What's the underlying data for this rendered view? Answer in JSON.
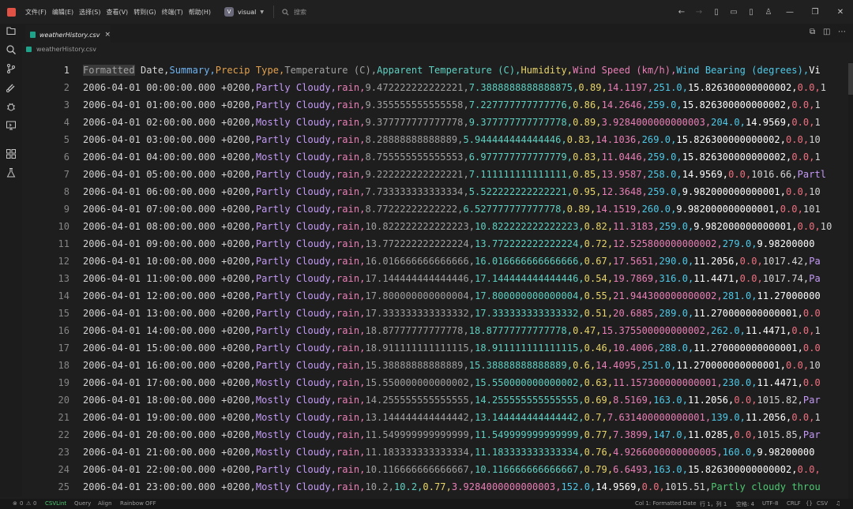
{
  "menu": [
    "文件(F)",
    "编辑(E)",
    "选择(S)",
    "查看(V)",
    "转到(G)",
    "终端(T)",
    "帮助(H)"
  ],
  "workspace": {
    "icon": "V",
    "name": "visual"
  },
  "search": {
    "placeholder": "搜索"
  },
  "tab": {
    "title": "weatherHistory.csv",
    "close": "×"
  },
  "breadcrumb": {
    "file": "weatherHistory.csv"
  },
  "colors": {
    "gray": "#a0a0a0",
    "blue": "#6fb3f0",
    "orange": "#e2a14e",
    "purple": "#c49af7",
    "teal": "#5fd1c2",
    "yellow": "#e8d56a",
    "pink": "#e97fb6",
    "cyan": "#4ec9e8",
    "white": "#ffffff",
    "green": "#4ec972",
    "red": "#f07080",
    "plain": "#d4d4d4"
  },
  "lines": [
    {
      "n": "1",
      "segs": [
        [
          "Formatted",
          "gray"
        ],
        [
          " Date,",
          "plain"
        ],
        [
          "Summary,",
          "blue"
        ],
        [
          "Precip Type,",
          "orange"
        ],
        [
          "Temperature (C),",
          "gray"
        ],
        [
          "Apparent Temperature (C),",
          "teal"
        ],
        [
          "Humidity,",
          "yellow"
        ],
        [
          "Wind Speed (km/h),",
          "pink"
        ],
        [
          "Wind Bearing (degrees),",
          "cyan"
        ],
        [
          "Vi",
          "white"
        ]
      ]
    },
    {
      "n": "2",
      "segs": [
        [
          "2006-04-01 00:00:00.000 +0200,",
          "plain"
        ],
        [
          "Partly Cloudy,",
          "purple"
        ],
        [
          "rain,",
          "pink"
        ],
        [
          "9.472222222222221,",
          "gray"
        ],
        [
          "7.3888888888888875,",
          "teal"
        ],
        [
          "0.89,",
          "yellow"
        ],
        [
          "14.1197,",
          "pink"
        ],
        [
          "251.0,",
          "cyan"
        ],
        [
          "15.826300000000002,",
          "white"
        ],
        [
          "0.0,",
          "red"
        ],
        [
          "1",
          "plain"
        ]
      ]
    },
    {
      "n": "3",
      "segs": [
        [
          "2006-04-01 01:00:00.000 +0200,",
          "plain"
        ],
        [
          "Partly Cloudy,",
          "purple"
        ],
        [
          "rain,",
          "pink"
        ],
        [
          "9.355555555555558,",
          "gray"
        ],
        [
          "7.227777777777776,",
          "teal"
        ],
        [
          "0.86,",
          "yellow"
        ],
        [
          "14.2646,",
          "pink"
        ],
        [
          "259.0,",
          "cyan"
        ],
        [
          "15.826300000000002,",
          "white"
        ],
        [
          "0.0,",
          "red"
        ],
        [
          "1",
          "plain"
        ]
      ]
    },
    {
      "n": "4",
      "segs": [
        [
          "2006-04-01 02:00:00.000 +0200,",
          "plain"
        ],
        [
          "Mostly Cloudy,",
          "purple"
        ],
        [
          "rain,",
          "pink"
        ],
        [
          "9.377777777777778,",
          "gray"
        ],
        [
          "9.377777777777778,",
          "teal"
        ],
        [
          "0.89,",
          "yellow"
        ],
        [
          "3.9284000000000003,",
          "pink"
        ],
        [
          "204.0,",
          "cyan"
        ],
        [
          "14.9569,",
          "white"
        ],
        [
          "0.0,",
          "red"
        ],
        [
          "1",
          "plain"
        ]
      ]
    },
    {
      "n": "5",
      "segs": [
        [
          "2006-04-01 03:00:00.000 +0200,",
          "plain"
        ],
        [
          "Partly Cloudy,",
          "purple"
        ],
        [
          "rain,",
          "pink"
        ],
        [
          "8.28888888888889,",
          "gray"
        ],
        [
          "5.944444444444446,",
          "teal"
        ],
        [
          "0.83,",
          "yellow"
        ],
        [
          "14.1036,",
          "pink"
        ],
        [
          "269.0,",
          "cyan"
        ],
        [
          "15.826300000000002,",
          "white"
        ],
        [
          "0.0,",
          "red"
        ],
        [
          "10",
          "plain"
        ]
      ]
    },
    {
      "n": "6",
      "segs": [
        [
          "2006-04-01 04:00:00.000 +0200,",
          "plain"
        ],
        [
          "Mostly Cloudy,",
          "purple"
        ],
        [
          "rain,",
          "pink"
        ],
        [
          "8.755555555555553,",
          "gray"
        ],
        [
          "6.977777777777779,",
          "teal"
        ],
        [
          "0.83,",
          "yellow"
        ],
        [
          "11.0446,",
          "pink"
        ],
        [
          "259.0,",
          "cyan"
        ],
        [
          "15.826300000000002,",
          "white"
        ],
        [
          "0.0,",
          "red"
        ],
        [
          "1",
          "plain"
        ]
      ]
    },
    {
      "n": "7",
      "segs": [
        [
          "2006-04-01 05:00:00.000 +0200,",
          "plain"
        ],
        [
          "Partly Cloudy,",
          "purple"
        ],
        [
          "rain,",
          "pink"
        ],
        [
          "9.222222222222221,",
          "gray"
        ],
        [
          "7.111111111111111,",
          "teal"
        ],
        [
          "0.85,",
          "yellow"
        ],
        [
          "13.9587,",
          "pink"
        ],
        [
          "258.0,",
          "cyan"
        ],
        [
          "14.9569,",
          "white"
        ],
        [
          "0.0,",
          "red"
        ],
        [
          "1016.66,",
          "plain"
        ],
        [
          "Partl",
          "purple"
        ]
      ]
    },
    {
      "n": "8",
      "segs": [
        [
          "2006-04-01 06:00:00.000 +0200,",
          "plain"
        ],
        [
          "Partly Cloudy,",
          "purple"
        ],
        [
          "rain,",
          "pink"
        ],
        [
          "7.733333333333334,",
          "gray"
        ],
        [
          "5.522222222222221,",
          "teal"
        ],
        [
          "0.95,",
          "yellow"
        ],
        [
          "12.3648,",
          "pink"
        ],
        [
          "259.0,",
          "cyan"
        ],
        [
          "9.982000000000001,",
          "white"
        ],
        [
          "0.0,",
          "red"
        ],
        [
          "10",
          "plain"
        ]
      ]
    },
    {
      "n": "9",
      "segs": [
        [
          "2006-04-01 07:00:00.000 +0200,",
          "plain"
        ],
        [
          "Partly Cloudy,",
          "purple"
        ],
        [
          "rain,",
          "pink"
        ],
        [
          "8.77222222222222,",
          "gray"
        ],
        [
          "6.527777777777778,",
          "teal"
        ],
        [
          "0.89,",
          "yellow"
        ],
        [
          "14.1519,",
          "pink"
        ],
        [
          "260.0,",
          "cyan"
        ],
        [
          "9.982000000000001,",
          "white"
        ],
        [
          "0.0,",
          "red"
        ],
        [
          "101",
          "plain"
        ]
      ]
    },
    {
      "n": "10",
      "segs": [
        [
          "2006-04-01 08:00:00.000 +0200,",
          "plain"
        ],
        [
          "Partly Cloudy,",
          "purple"
        ],
        [
          "rain,",
          "pink"
        ],
        [
          "10.822222222222223,",
          "gray"
        ],
        [
          "10.822222222222223,",
          "teal"
        ],
        [
          "0.82,",
          "yellow"
        ],
        [
          "11.3183,",
          "pink"
        ],
        [
          "259.0,",
          "cyan"
        ],
        [
          "9.982000000000001,",
          "white"
        ],
        [
          "0.0,",
          "red"
        ],
        [
          "10",
          "plain"
        ]
      ]
    },
    {
      "n": "11",
      "segs": [
        [
          "2006-04-01 09:00:00.000 +0200,",
          "plain"
        ],
        [
          "Partly Cloudy,",
          "purple"
        ],
        [
          "rain,",
          "pink"
        ],
        [
          "13.772222222222224,",
          "gray"
        ],
        [
          "13.772222222222224,",
          "teal"
        ],
        [
          "0.72,",
          "yellow"
        ],
        [
          "12.525800000000002,",
          "pink"
        ],
        [
          "279.0,",
          "cyan"
        ],
        [
          "9.98200000",
          "white"
        ]
      ]
    },
    {
      "n": "12",
      "segs": [
        [
          "2006-04-01 10:00:00.000 +0200,",
          "plain"
        ],
        [
          "Partly Cloudy,",
          "purple"
        ],
        [
          "rain,",
          "pink"
        ],
        [
          "16.016666666666666,",
          "gray"
        ],
        [
          "16.016666666666666,",
          "teal"
        ],
        [
          "0.67,",
          "yellow"
        ],
        [
          "17.5651,",
          "pink"
        ],
        [
          "290.0,",
          "cyan"
        ],
        [
          "11.2056,",
          "white"
        ],
        [
          "0.0,",
          "red"
        ],
        [
          "1017.42,",
          "plain"
        ],
        [
          "Pa",
          "purple"
        ]
      ]
    },
    {
      "n": "13",
      "segs": [
        [
          "2006-04-01 11:00:00.000 +0200,",
          "plain"
        ],
        [
          "Partly Cloudy,",
          "purple"
        ],
        [
          "rain,",
          "pink"
        ],
        [
          "17.144444444444446,",
          "gray"
        ],
        [
          "17.144444444444446,",
          "teal"
        ],
        [
          "0.54,",
          "yellow"
        ],
        [
          "19.7869,",
          "pink"
        ],
        [
          "316.0,",
          "cyan"
        ],
        [
          "11.4471,",
          "white"
        ],
        [
          "0.0,",
          "red"
        ],
        [
          "1017.74,",
          "plain"
        ],
        [
          "Pa",
          "purple"
        ]
      ]
    },
    {
      "n": "14",
      "segs": [
        [
          "2006-04-01 12:00:00.000 +0200,",
          "plain"
        ],
        [
          "Partly Cloudy,",
          "purple"
        ],
        [
          "rain,",
          "pink"
        ],
        [
          "17.800000000000004,",
          "gray"
        ],
        [
          "17.800000000000004,",
          "teal"
        ],
        [
          "0.55,",
          "yellow"
        ],
        [
          "21.944300000000002,",
          "pink"
        ],
        [
          "281.0,",
          "cyan"
        ],
        [
          "11.27000000",
          "white"
        ]
      ]
    },
    {
      "n": "15",
      "segs": [
        [
          "2006-04-01 13:00:00.000 +0200,",
          "plain"
        ],
        [
          "Partly Cloudy,",
          "purple"
        ],
        [
          "rain,",
          "pink"
        ],
        [
          "17.333333333333332,",
          "gray"
        ],
        [
          "17.333333333333332,",
          "teal"
        ],
        [
          "0.51,",
          "yellow"
        ],
        [
          "20.6885,",
          "pink"
        ],
        [
          "289.0,",
          "cyan"
        ],
        [
          "11.270000000000001,",
          "white"
        ],
        [
          "0.0",
          "red"
        ]
      ]
    },
    {
      "n": "16",
      "segs": [
        [
          "2006-04-01 14:00:00.000 +0200,",
          "plain"
        ],
        [
          "Partly Cloudy,",
          "purple"
        ],
        [
          "rain,",
          "pink"
        ],
        [
          "18.87777777777778,",
          "gray"
        ],
        [
          "18.87777777777778,",
          "teal"
        ],
        [
          "0.47,",
          "yellow"
        ],
        [
          "15.375500000000002,",
          "pink"
        ],
        [
          "262.0,",
          "cyan"
        ],
        [
          "11.4471,",
          "white"
        ],
        [
          "0.0,",
          "red"
        ],
        [
          "1",
          "plain"
        ]
      ]
    },
    {
      "n": "17",
      "segs": [
        [
          "2006-04-01 15:00:00.000 +0200,",
          "plain"
        ],
        [
          "Partly Cloudy,",
          "purple"
        ],
        [
          "rain,",
          "pink"
        ],
        [
          "18.911111111111115,",
          "gray"
        ],
        [
          "18.911111111111115,",
          "teal"
        ],
        [
          "0.46,",
          "yellow"
        ],
        [
          "10.4006,",
          "pink"
        ],
        [
          "288.0,",
          "cyan"
        ],
        [
          "11.270000000000001,",
          "white"
        ],
        [
          "0.0",
          "red"
        ]
      ]
    },
    {
      "n": "18",
      "segs": [
        [
          "2006-04-01 16:00:00.000 +0200,",
          "plain"
        ],
        [
          "Partly Cloudy,",
          "purple"
        ],
        [
          "rain,",
          "pink"
        ],
        [
          "15.38888888888889,",
          "gray"
        ],
        [
          "15.38888888888889,",
          "teal"
        ],
        [
          "0.6,",
          "yellow"
        ],
        [
          "14.4095,",
          "pink"
        ],
        [
          "251.0,",
          "cyan"
        ],
        [
          "11.270000000000001,",
          "white"
        ],
        [
          "0.0,",
          "red"
        ],
        [
          "10",
          "plain"
        ]
      ]
    },
    {
      "n": "19",
      "segs": [
        [
          "2006-04-01 17:00:00.000 +0200,",
          "plain"
        ],
        [
          "Mostly Cloudy,",
          "purple"
        ],
        [
          "rain,",
          "pink"
        ],
        [
          "15.550000000000002,",
          "gray"
        ],
        [
          "15.550000000000002,",
          "teal"
        ],
        [
          "0.63,",
          "yellow"
        ],
        [
          "11.157300000000001,",
          "pink"
        ],
        [
          "230.0,",
          "cyan"
        ],
        [
          "11.4471,",
          "white"
        ],
        [
          "0.0",
          "red"
        ]
      ]
    },
    {
      "n": "20",
      "segs": [
        [
          "2006-04-01 18:00:00.000 +0200,",
          "plain"
        ],
        [
          "Mostly Cloudy,",
          "purple"
        ],
        [
          "rain,",
          "pink"
        ],
        [
          "14.255555555555555,",
          "gray"
        ],
        [
          "14.255555555555555,",
          "teal"
        ],
        [
          "0.69,",
          "yellow"
        ],
        [
          "8.5169,",
          "pink"
        ],
        [
          "163.0,",
          "cyan"
        ],
        [
          "11.2056,",
          "white"
        ],
        [
          "0.0,",
          "red"
        ],
        [
          "1015.82,",
          "plain"
        ],
        [
          "Par",
          "purple"
        ]
      ]
    },
    {
      "n": "21",
      "segs": [
        [
          "2006-04-01 19:00:00.000 +0200,",
          "plain"
        ],
        [
          "Mostly Cloudy,",
          "purple"
        ],
        [
          "rain,",
          "pink"
        ],
        [
          "13.144444444444442,",
          "gray"
        ],
        [
          "13.144444444444442,",
          "teal"
        ],
        [
          "0.7,",
          "yellow"
        ],
        [
          "7.631400000000001,",
          "pink"
        ],
        [
          "139.0,",
          "cyan"
        ],
        [
          "11.2056,",
          "white"
        ],
        [
          "0.0,",
          "red"
        ],
        [
          "1",
          "plain"
        ]
      ]
    },
    {
      "n": "22",
      "segs": [
        [
          "2006-04-01 20:00:00.000 +0200,",
          "plain"
        ],
        [
          "Mostly Cloudy,",
          "purple"
        ],
        [
          "rain,",
          "pink"
        ],
        [
          "11.549999999999999,",
          "gray"
        ],
        [
          "11.549999999999999,",
          "teal"
        ],
        [
          "0.77,",
          "yellow"
        ],
        [
          "7.3899,",
          "pink"
        ],
        [
          "147.0,",
          "cyan"
        ],
        [
          "11.0285,",
          "white"
        ],
        [
          "0.0,",
          "red"
        ],
        [
          "1015.85,",
          "plain"
        ],
        [
          "Par",
          "purple"
        ]
      ]
    },
    {
      "n": "23",
      "segs": [
        [
          "2006-04-01 21:00:00.000 +0200,",
          "plain"
        ],
        [
          "Mostly Cloudy,",
          "purple"
        ],
        [
          "rain,",
          "pink"
        ],
        [
          "11.183333333333334,",
          "gray"
        ],
        [
          "11.183333333333334,",
          "teal"
        ],
        [
          "0.76,",
          "yellow"
        ],
        [
          "4.9266000000000005,",
          "pink"
        ],
        [
          "160.0,",
          "cyan"
        ],
        [
          "9.98200000",
          "white"
        ]
      ]
    },
    {
      "n": "24",
      "segs": [
        [
          "2006-04-01 22:00:00.000 +0200,",
          "plain"
        ],
        [
          "Partly Cloudy,",
          "purple"
        ],
        [
          "rain,",
          "pink"
        ],
        [
          "10.116666666666667,",
          "gray"
        ],
        [
          "10.116666666666667,",
          "teal"
        ],
        [
          "0.79,",
          "yellow"
        ],
        [
          "6.6493,",
          "pink"
        ],
        [
          "163.0,",
          "cyan"
        ],
        [
          "15.826300000000002,",
          "white"
        ],
        [
          "0.0,",
          "red"
        ]
      ]
    },
    {
      "n": "25",
      "segs": [
        [
          "2006-04-01 23:00:00.000 +0200,",
          "plain"
        ],
        [
          "Mostly Cloudy,",
          "purple"
        ],
        [
          "rain,",
          "pink"
        ],
        [
          "10.2,",
          "gray"
        ],
        [
          "10.2,",
          "teal"
        ],
        [
          "0.77,",
          "yellow"
        ],
        [
          "3.9284000000000003,",
          "pink"
        ],
        [
          "152.0,",
          "cyan"
        ],
        [
          "14.9569,",
          "white"
        ],
        [
          "0.0,",
          "red"
        ],
        [
          "1015.51,",
          "plain"
        ],
        [
          "Partly cloudy throu",
          "green"
        ]
      ]
    }
  ],
  "status": {
    "errors": "0",
    "warnings": "0",
    "plugin": "CSVLint",
    "query": "Query",
    "align": "Align",
    "rainbow": "Rainbow OFF",
    "col": "Col 1: Formatted Date",
    "position": "行 1，列 1",
    "spaces": "空格: 4",
    "encoding": "UTF-8",
    "eol": "CRLF",
    "lang": "CSV"
  }
}
